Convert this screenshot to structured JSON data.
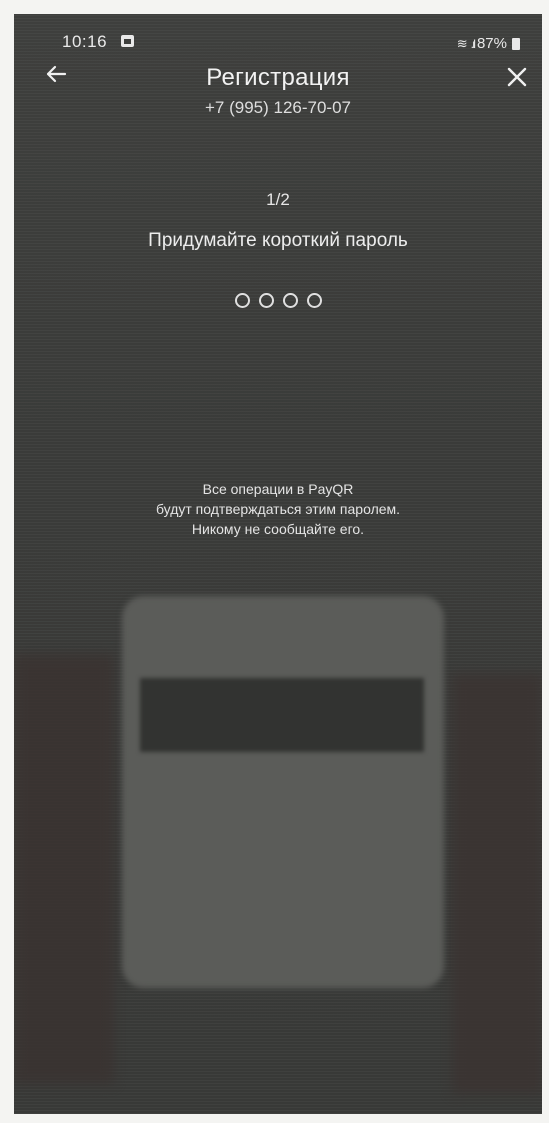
{
  "status_bar": {
    "time": "10:16",
    "battery": "87%",
    "icons": [
      "gallery-icon",
      "wifi-icon",
      "signal-icon",
      "battery-icon"
    ]
  },
  "header": {
    "title": "Регистрация",
    "phone": "+7 (995) 126-70-07",
    "back_icon": "arrow-left-icon",
    "close_icon": "close-icon"
  },
  "registration": {
    "step": "1/2",
    "prompt": "Придумайте короткий пароль",
    "pin_length": 4,
    "pin_filled": 0
  },
  "info": {
    "lines": [
      "Все операции в PayQR",
      "будут подтверждаться этим паролем.",
      "Никому не сообщайте его."
    ]
  },
  "colors": {
    "background": "#3c3d3b",
    "text": "#efefef"
  }
}
